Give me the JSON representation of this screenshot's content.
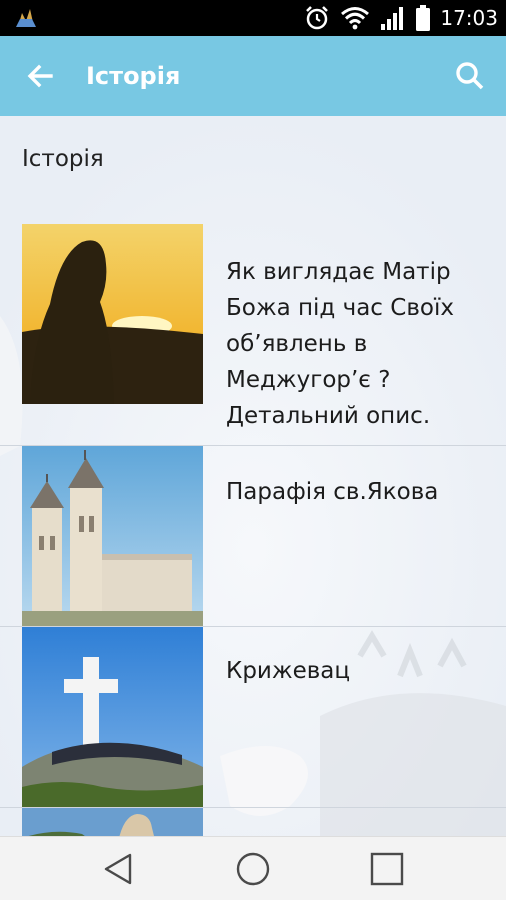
{
  "status_bar": {
    "time": "17:03",
    "icons": [
      "app-notification-icon",
      "alarm-icon",
      "wifi-icon",
      "signal-icon",
      "battery-icon"
    ]
  },
  "app_bar": {
    "title": "Історія",
    "back_icon": "arrow-back-icon",
    "search_icon": "search-icon",
    "color": "#78c8e3"
  },
  "content": {
    "heading": "Історія",
    "items": [
      {
        "label": " Як виглядає Матір Божа під час Своїх об’явлень в Меджугор’є ? Детальний опис.",
        "image": "madonna-sunset-image"
      },
      {
        "label": "Парафія св.Якова",
        "image": "church-of-st-james-image"
      },
      {
        "label": "Крижевац",
        "image": "cross-on-hill-image"
      },
      {
        "label": "",
        "image": "statue-image"
      }
    ]
  },
  "nav_bar": {
    "icons": [
      "back-triangle-icon",
      "home-circle-icon",
      "recents-square-icon"
    ]
  }
}
